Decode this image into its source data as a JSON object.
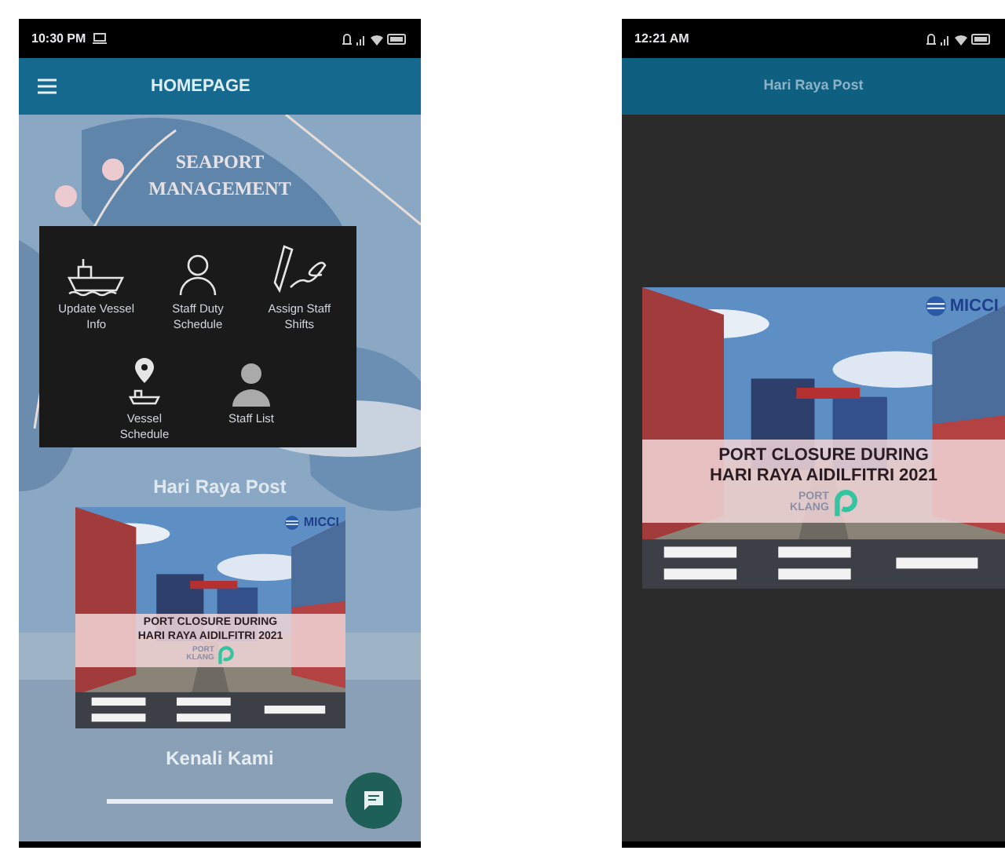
{
  "screens": [
    {
      "kind": "home",
      "status_time": "10:30 PM",
      "title": "HOMEPAGE",
      "hero": [
        "SEAPORT",
        "MANAGEMENT"
      ],
      "menu": [
        {
          "kind": "ship",
          "label": "Update Vessel Info"
        },
        {
          "kind": "person",
          "label": "Staff Duty Schedule"
        },
        {
          "kind": "pencil",
          "label": "Assign Staff Shifts"
        },
        {
          "kind": "pin",
          "label": "Vessel Schedule"
        },
        {
          "kind": "user",
          "label": "Staff List"
        }
      ],
      "post_heading": "Hari Raya Post",
      "poster": {
        "brand": "MICCI",
        "lines": [
          "PORT CLOSURE DURING",
          "HARI RAYA AIDILFITRI 2021"
        ],
        "logo": [
          "PORT",
          "KLANG"
        ]
      },
      "footer_heading": "Kenali Kami"
    },
    {
      "kind": "post",
      "status_time": "12:21 AM",
      "title": "Hari Raya Post",
      "poster": {
        "brand": "MICCI",
        "lines": [
          "PORT CLOSURE DURING",
          "HARI RAYA AIDILFITRI 2021"
        ],
        "logo": [
          "PORT",
          "KLANG"
        ]
      }
    }
  ]
}
